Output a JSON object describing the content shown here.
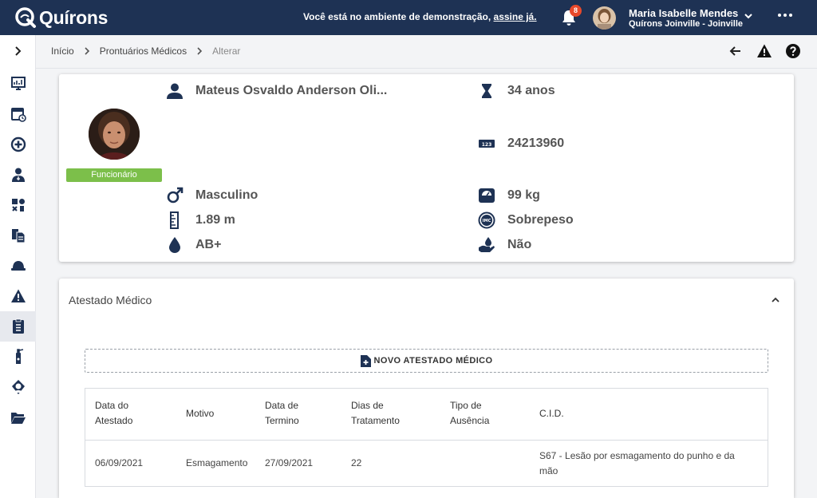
{
  "app": {
    "logo_text": "Quírons",
    "demo_message": "Você está no ambiente de demonstração, ",
    "demo_link": "assine já.",
    "notifications_count": "8",
    "user_name": "Maria Isabelle Mendes",
    "user_org": "Quírons Joinville - Joinville"
  },
  "breadcrumb": {
    "items": [
      "Início",
      "Prontuários Médicos",
      "Alterar"
    ]
  },
  "patient": {
    "name": "Mateus Osvaldo Anderson Oli...",
    "age": "34 anos",
    "id_number": "24213960",
    "badge": "Funcionário",
    "sex": "Masculino",
    "weight": "99 kg",
    "height": "1.89 m",
    "bmi_status": "Sobrepeso",
    "blood_type": "AB+",
    "donor": "Não"
  },
  "atestado": {
    "section_title": "Atestado Médico",
    "new_button": "NOVO ATESTADO MÉDICO",
    "columns": [
      [
        "Data do",
        "Atestado"
      ],
      [
        "Motivo"
      ],
      [
        "Data de",
        "Termino"
      ],
      [
        "Dias de",
        "Tratamento"
      ],
      [
        "Tipo de",
        "Ausência"
      ],
      [
        "C.I.D."
      ]
    ],
    "rows": [
      {
        "data_atestado": "06/09/2021",
        "motivo": "Esmagamento",
        "data_termino": "27/09/2021",
        "dias": "22",
        "tipo": "",
        "cid_line1": "S67 - Lesão por esmagamento do punho e da",
        "cid_line2": "mão"
      }
    ]
  },
  "colors": {
    "topbar": "#1e3254",
    "icon": "#1e3254",
    "badge_green": "#7cbf4a",
    "notification_red": "#e8492b"
  }
}
